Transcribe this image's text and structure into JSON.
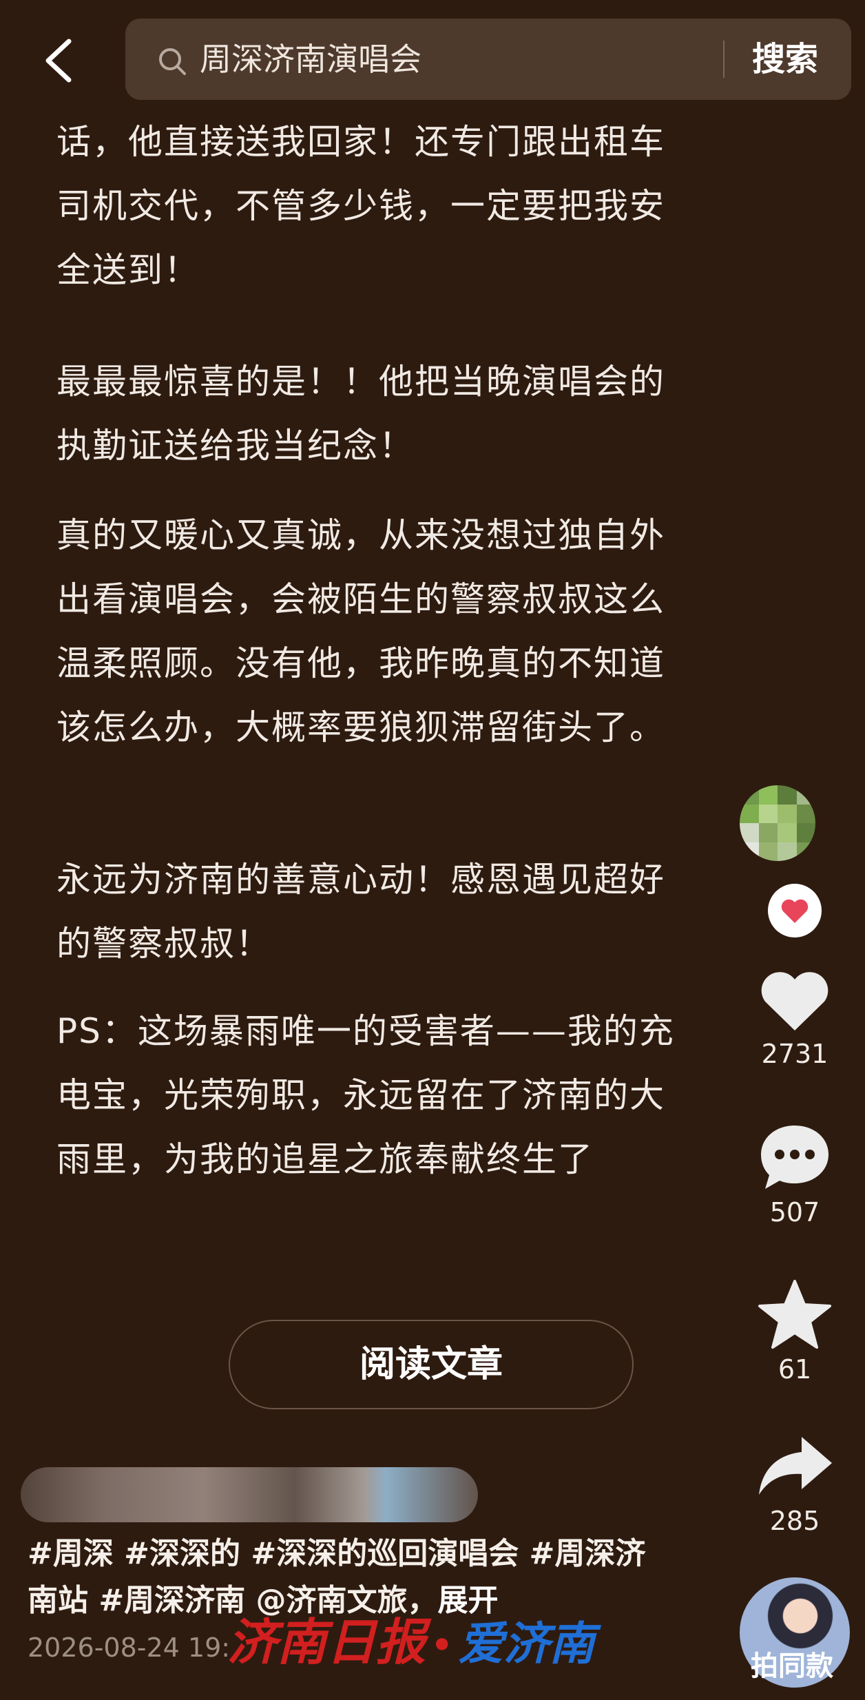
{
  "search": {
    "query": "周深济南演唱会",
    "button_label": "搜索"
  },
  "article": {
    "paragraphs": [
      "话，他直接送我回家！还专门跟出租车司机交代，不管多少钱，一定要把我安全送到！",
      "最最最惊喜的是！！他把当晚演唱会的执勤证送给我当纪念！",
      "真的又暖心又真诚，从来没想过独自外出看演唱会，会被陌生的警察叔叔这么温柔照顾。没有他，我昨晚真的不知道该怎么办，大概率要狼狈滞留街头了。",
      "永远为济南的善意心动！感恩遇见超好的警察叔叔！",
      "PS：这场暴雨唯一的受害者——我的充电宝，光荣殉职，永远留在了济南的大雨里，为我的追星之旅奉献终生了"
    ],
    "read_button": "阅读文章"
  },
  "actions": {
    "likes": "2731",
    "comments": "507",
    "favorites": "61",
    "shares": "285"
  },
  "post": {
    "tags": "#周深 #深深的 #深深的巡回演唱会 #周深济南站 #周深济南 @济南文旅",
    "expand": "展开",
    "date": "2026-08-24 19:",
    "same_style_label": "拍同款"
  },
  "watermark": {
    "left": "济南日报",
    "dot": "•",
    "right": "爱济南"
  },
  "colors": {
    "background": "#2e1b10",
    "search_bg": "#4e3a2d",
    "text": "#f1eae4",
    "watermark_red": "#d21f1f",
    "watermark_blue": "#1f6fd6",
    "follow_heart": "#e8455a"
  },
  "icons": [
    "back-arrow-icon",
    "search-icon",
    "heart-icon",
    "comment-icon",
    "star-icon",
    "share-icon",
    "follow-heart-icon"
  ]
}
